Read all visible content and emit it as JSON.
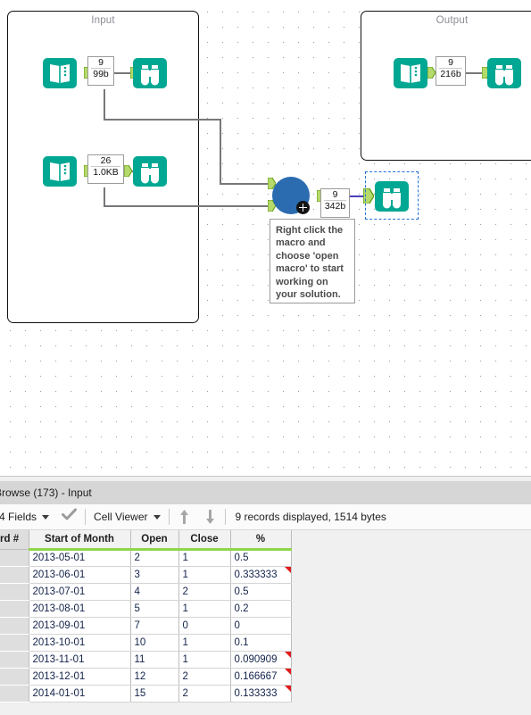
{
  "canvas": {
    "containers": [
      {
        "name": "input-container",
        "title": "Input"
      },
      {
        "name": "output-container",
        "title": "Output"
      }
    ],
    "tools": [
      {
        "name": "input-tool-1",
        "icon": "input-data-icon",
        "records": "9",
        "size": "99b"
      },
      {
        "name": "browse-tool-1",
        "icon": "browse-binoculars-icon"
      },
      {
        "name": "input-tool-2",
        "icon": "input-data-icon",
        "records": "26",
        "size": "1.0KB"
      },
      {
        "name": "browse-tool-2",
        "icon": "browse-binoculars-icon"
      },
      {
        "name": "input-tool-3",
        "icon": "input-data-icon",
        "records": "9",
        "size": "216b"
      },
      {
        "name": "browse-tool-3",
        "icon": "browse-binoculars-icon"
      },
      {
        "name": "macro-tool",
        "icon": "macro-circle-icon",
        "records": "9",
        "size": "342b"
      },
      {
        "name": "browse-tool-selected",
        "icon": "browse-binoculars-icon"
      }
    ],
    "annotation": "Right click the macro and choose 'open macro' to start working on your solution.",
    "colors": {
      "tool_teal": "#00a792",
      "macro_blue": "#2b6cb0",
      "connector_green": "#8cc63f",
      "wire_gray": "#77777b",
      "wire_selected": "#4a3fbe",
      "selection_blue": "#1f6fd6"
    }
  },
  "results": {
    "title": "Browse (173) - Input",
    "toolbar": {
      "fields_label": "4 Fields",
      "check_icon": "checkmark-icon",
      "viewer_label": "Cell Viewer",
      "sort_asc_icon": "arrow-up-icon",
      "sort_desc_icon": "arrow-down-icon",
      "record_summary": "9 records displayed, 1514 bytes"
    },
    "table": {
      "columns": [
        "rd #",
        "Start of Month",
        "Open",
        "Close",
        "%"
      ],
      "rows": [
        {
          "num": "",
          "month": "2013-05-01",
          "open": "2",
          "close": "1",
          "pct": "0.5",
          "flag": false
        },
        {
          "num": "",
          "month": "2013-06-01",
          "open": "3",
          "close": "1",
          "pct": "0.333333",
          "flag": true
        },
        {
          "num": "",
          "month": "2013-07-01",
          "open": "4",
          "close": "2",
          "pct": "0.5",
          "flag": false
        },
        {
          "num": "",
          "month": "2013-08-01",
          "open": "5",
          "close": "1",
          "pct": "0.2",
          "flag": false
        },
        {
          "num": "",
          "month": "2013-09-01",
          "open": "7",
          "close": "0",
          "pct": "0",
          "flag": false
        },
        {
          "num": "",
          "month": "2013-10-01",
          "open": "10",
          "close": "1",
          "pct": "0.1",
          "flag": false
        },
        {
          "num": "",
          "month": "2013-11-01",
          "open": "11",
          "close": "1",
          "pct": "0.090909",
          "flag": true
        },
        {
          "num": "",
          "month": "2013-12-01",
          "open": "12",
          "close": "2",
          "pct": "0.166667",
          "flag": true
        },
        {
          "num": "",
          "month": "2014-01-01",
          "open": "15",
          "close": "2",
          "pct": "0.133333",
          "flag": true
        }
      ]
    }
  }
}
